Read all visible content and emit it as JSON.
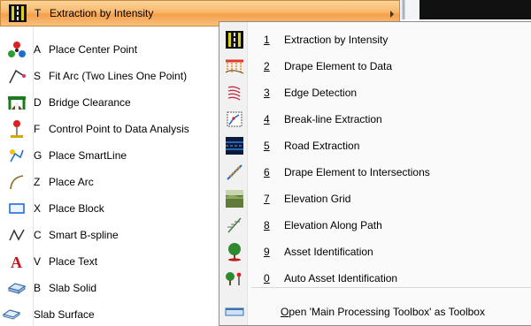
{
  "left_menu": {
    "items": [
      {
        "key": "T",
        "label": "Extraction by Intensity",
        "icon": "extraction-intensity-icon"
      },
      {
        "key": "A",
        "label": "Place Center Point",
        "icon": "center-point-icon"
      },
      {
        "key": "S",
        "label": "Fit Arc (Two Lines One Point)",
        "icon": "fit-arc-icon"
      },
      {
        "key": "D",
        "label": "Bridge Clearance",
        "icon": "bridge-clearance-icon"
      },
      {
        "key": "F",
        "label": "Control Point to Data Analysis",
        "icon": "control-point-icon"
      },
      {
        "key": "G",
        "label": "Place SmartLine",
        "icon": "smartline-icon"
      },
      {
        "key": "Z",
        "label": "Place Arc",
        "icon": "arc-icon"
      },
      {
        "key": "X",
        "label": "Place Block",
        "icon": "block-icon"
      },
      {
        "key": "C",
        "label": "Smart B-spline",
        "icon": "bspline-icon"
      },
      {
        "key": "V",
        "label": "Place Text",
        "icon": "text-icon"
      },
      {
        "key": "B",
        "label": "Slab Solid",
        "icon": "slab-solid-icon"
      },
      {
        "key": "",
        "label": "Slab Surface",
        "icon": "slab-surface-icon"
      }
    ]
  },
  "sub_menu": {
    "items": [
      {
        "num": "1",
        "label": "Extraction by Intensity",
        "icon": "extraction-intensity-icon"
      },
      {
        "num": "2",
        "label": "Drape Element to Data",
        "icon": "drape-element-icon"
      },
      {
        "num": "3",
        "label": "Edge Detection",
        "icon": "edge-detection-icon"
      },
      {
        "num": "4",
        "label": "Break-line Extraction",
        "icon": "breakline-icon"
      },
      {
        "num": "5",
        "label": "Road Extraction",
        "icon": "road-extraction-icon"
      },
      {
        "num": "6",
        "label": "Drape Element to Intersections",
        "icon": "drape-intersections-icon"
      },
      {
        "num": "7",
        "label": "Elevation Grid",
        "icon": "elevation-grid-icon"
      },
      {
        "num": "8",
        "label": "Elevation Along Path",
        "icon": "elevation-path-icon"
      },
      {
        "num": "9",
        "label": "Asset Identification",
        "icon": "asset-identification-icon"
      },
      {
        "num": "0",
        "label": "Auto Asset Identification",
        "icon": "auto-asset-icon"
      }
    ],
    "open_toolbox": {
      "label_prefix": "O",
      "label_rest": "pen 'Main Processing Toolbox' as Toolbox",
      "icon": "toolbox-icon"
    }
  },
  "colors": {
    "highlight": "#f9b86b",
    "accent_blue": "#1f6fd1"
  }
}
